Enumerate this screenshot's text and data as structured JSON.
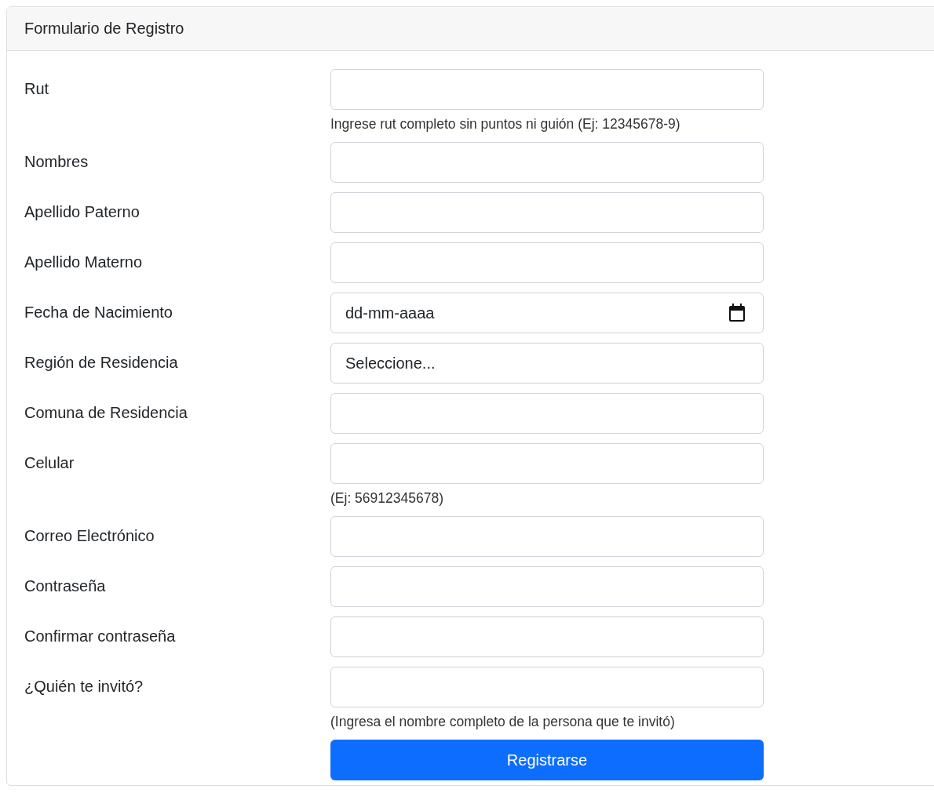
{
  "card": {
    "title": "Formulario de Registro"
  },
  "fields": [
    {
      "kind": "text",
      "label": "Rut",
      "help": "Ingrese rut completo sin puntos ni guión (Ej: 12345678-9)"
    },
    {
      "kind": "text",
      "label": "Nombres"
    },
    {
      "kind": "text",
      "label": "Apellido Paterno"
    },
    {
      "kind": "text",
      "label": "Apellido Materno"
    },
    {
      "kind": "date",
      "label": "Fecha de Nacimiento",
      "placeholder": "dd-mm-aaaa"
    },
    {
      "kind": "select",
      "label": "Región de Residencia",
      "value": "Seleccione..."
    },
    {
      "kind": "text",
      "label": "Comuna de Residencia"
    },
    {
      "kind": "text",
      "label": "Celular",
      "help": "(Ej: 56912345678)"
    },
    {
      "kind": "text",
      "label": "Correo Electrónico"
    },
    {
      "kind": "text",
      "label": "Contraseña"
    },
    {
      "kind": "text",
      "label": "Confirmar contraseña"
    },
    {
      "kind": "text",
      "label": "¿Quién te invitó?",
      "help": "(Ingresa el nombre completo de la persona que te invitó)"
    }
  ],
  "submit": {
    "label": "Registrarse"
  }
}
